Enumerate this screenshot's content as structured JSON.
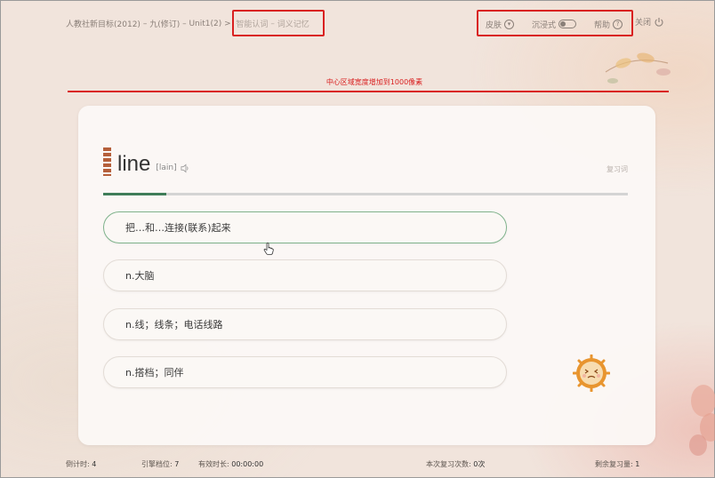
{
  "breadcrumb": {
    "book": "人教社新目标(2012)",
    "grade": "九(修订)",
    "unit": "Unit1(2)",
    "mode": "智能认词",
    "submode": "词义记忆",
    "sep": "–",
    "arrow": ">"
  },
  "topbar": {
    "skin_label": "皮肤",
    "immersive_label": "沉浸式",
    "help_label": "帮助",
    "close_label": "关闭"
  },
  "annotation": {
    "text": "中心区域宽度增加到1000像素"
  },
  "word": {
    "text": "line",
    "phonetic": "[lain]",
    "review_label": "复习词"
  },
  "progress": {
    "fraction": 0.12
  },
  "options": [
    "把…和…连接(联系)起来",
    "n.大脑",
    "n.线；线条；电话线路",
    "n.搭档；同伴"
  ],
  "status": {
    "countdown_label": "倒计时:",
    "countdown_value": "4",
    "engine_label": "引擎档位:",
    "engine_value": "7",
    "duration_label": "有效时长:",
    "duration_value": "00:00:00",
    "review_count_label": "本次复习次数:",
    "review_count_value": "0次",
    "remaining_label": "剩余复习量:",
    "remaining_value": "1"
  },
  "colors": {
    "accent_green": "#3f7d59",
    "annotation_red": "#d92020",
    "word_bar": "#b55f3a"
  }
}
